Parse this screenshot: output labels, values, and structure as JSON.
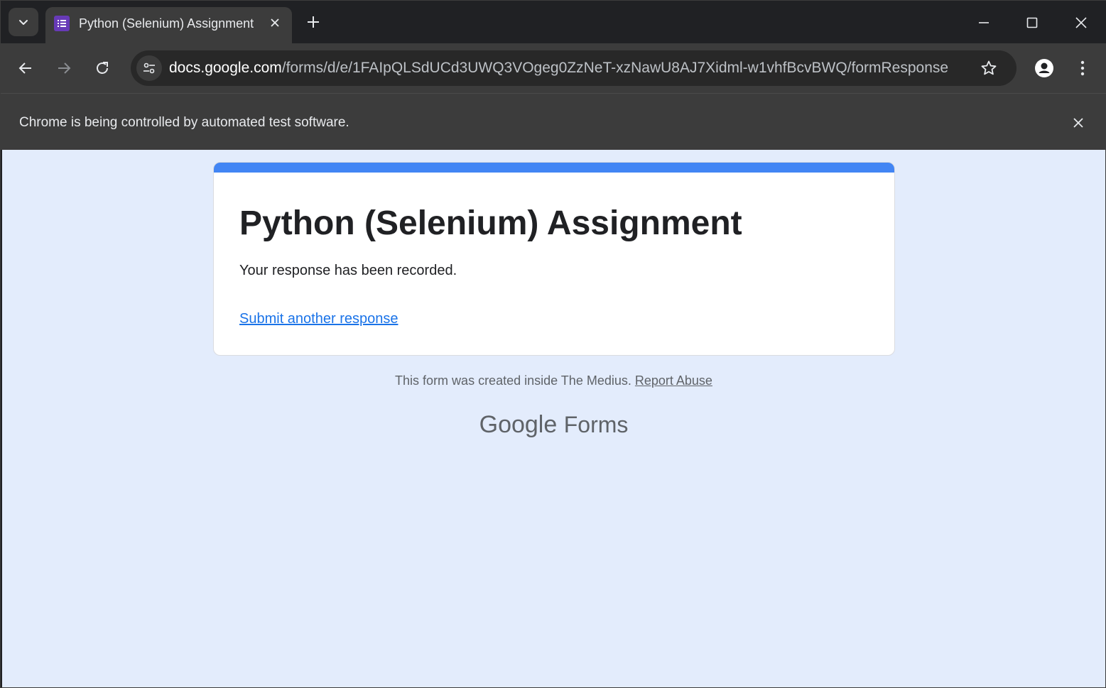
{
  "tab": {
    "title": "Python (Selenium) Assignment",
    "new_tab_label": "+"
  },
  "toolbar": {
    "url_host": "docs.google.com",
    "url_path": "/forms/d/e/1FAIpQLSdUCd3UWQ3VOgeg0ZzNeT-xzNawU8AJ7Xidml-w1vhfBcvBWQ/formResponse"
  },
  "infobar": {
    "message": "Chrome is being controlled by automated test software."
  },
  "form": {
    "title": "Python (Selenium) Assignment",
    "confirmation": "Your response has been recorded.",
    "submit_another": "Submit another response"
  },
  "footer": {
    "note": "This form was created inside The Medius.",
    "report_abuse": "Report Abuse",
    "brand_google": "Google",
    "brand_forms": "Forms"
  },
  "colors": {
    "accent": "#4285f4",
    "page_bg": "#e3ecfc",
    "link": "#1a73e8",
    "favicon": "#673ab7"
  }
}
